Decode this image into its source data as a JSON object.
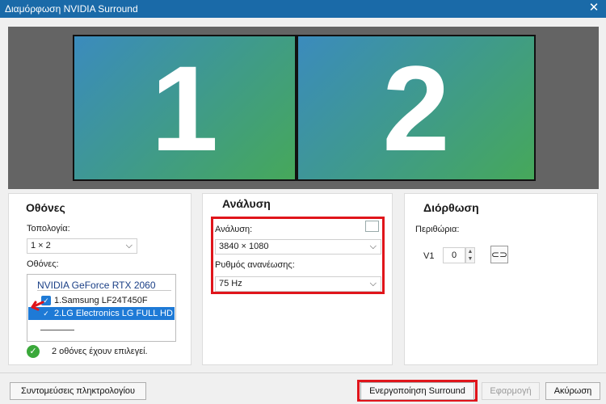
{
  "window": {
    "title": "Διαμόρφωση NVIDIA Surround",
    "close_glyph": "✕"
  },
  "preview": {
    "monitors": [
      "1",
      "2"
    ],
    "gradient_colors": [
      "#3b8bbd",
      "#46a85a"
    ]
  },
  "displays_panel": {
    "title": "Οθόνες",
    "topology_label": "Τοπολογία:",
    "topology_value": "1 × 2",
    "displays_label": "Οθόνες:",
    "gpu_name": "NVIDIA GeForce RTX 2060",
    "items": [
      {
        "label": "1.Samsung LF24T450F",
        "checked": true,
        "selected": false
      },
      {
        "label": "2.LG Electronics LG FULL HD",
        "checked": true,
        "selected": true
      }
    ],
    "status_text": "2 οθόνες έχουν επιλεγεί."
  },
  "resolution_panel": {
    "title": "Ανάλυση",
    "resolution_label": "Ανάλυση:",
    "resolution_value": "3840 × 1080",
    "refresh_label": "Ρυθμός ανανέωσης:",
    "refresh_value": "75  Hz"
  },
  "bezel_panel": {
    "title": "Διόρθωση",
    "margins_label": "Περιθώρια:",
    "v1_label": "V1",
    "v1_value": "0"
  },
  "buttons": {
    "shortcuts": "Συντομεύσεις πληκτρολογίου",
    "enable_surround": "Ενεργοποίηση Surround",
    "apply": "Εφαρμογή",
    "cancel": "Ακύρωση"
  },
  "colors": {
    "titlebar": "#1a6aa8",
    "highlight_red": "#e0151b",
    "selection_blue": "#1e7ad6",
    "ok_green": "#3aa83a"
  }
}
